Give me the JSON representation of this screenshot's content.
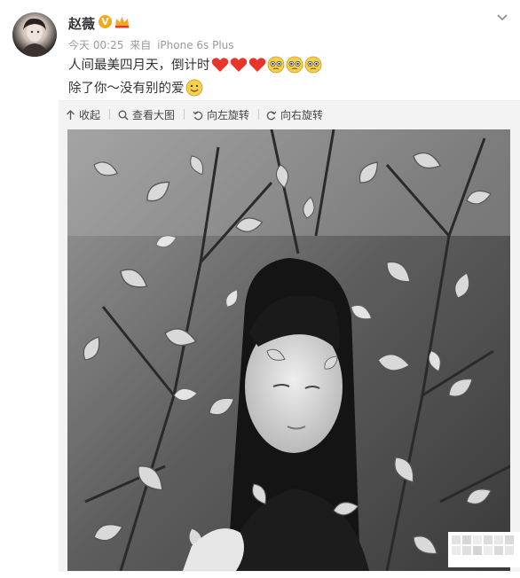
{
  "post": {
    "username": "赵薇",
    "verified_badge": "V",
    "icons": {
      "avatar": "user-avatar",
      "verified": "verified-v-icon",
      "vip": "vip-crown-icon",
      "menu": "chevron-down-icon"
    },
    "meta": {
      "time": "今天 00:25",
      "source_prefix": "来自",
      "device": "iPhone 6s Plus"
    },
    "text_line1": "人间最美四月天，倒计时",
    "text_line1_emoji": [
      "heart-emoji",
      "heart-emoji",
      "heart-emoji",
      "pleading-face-emoji",
      "pleading-face-emoji",
      "pleading-face-emoji"
    ],
    "text_line2": "除了你～没有别的爱",
    "text_line2_emoji": [
      "smile-emoji"
    ]
  },
  "toolbar": {
    "collapse": "收起",
    "view_large": "查看大图",
    "rotate_left": "向左旋转",
    "rotate_right": "向右旋转"
  },
  "photo": {
    "description_icon": "photo-image",
    "style": "black-and-white"
  },
  "colors": {
    "accent_orange": "#f3a81a",
    "heart_red": "#e8352b",
    "text": "#333333",
    "meta_gray": "#9a9a9a",
    "toolbar_bg": "#f3f3f3"
  }
}
